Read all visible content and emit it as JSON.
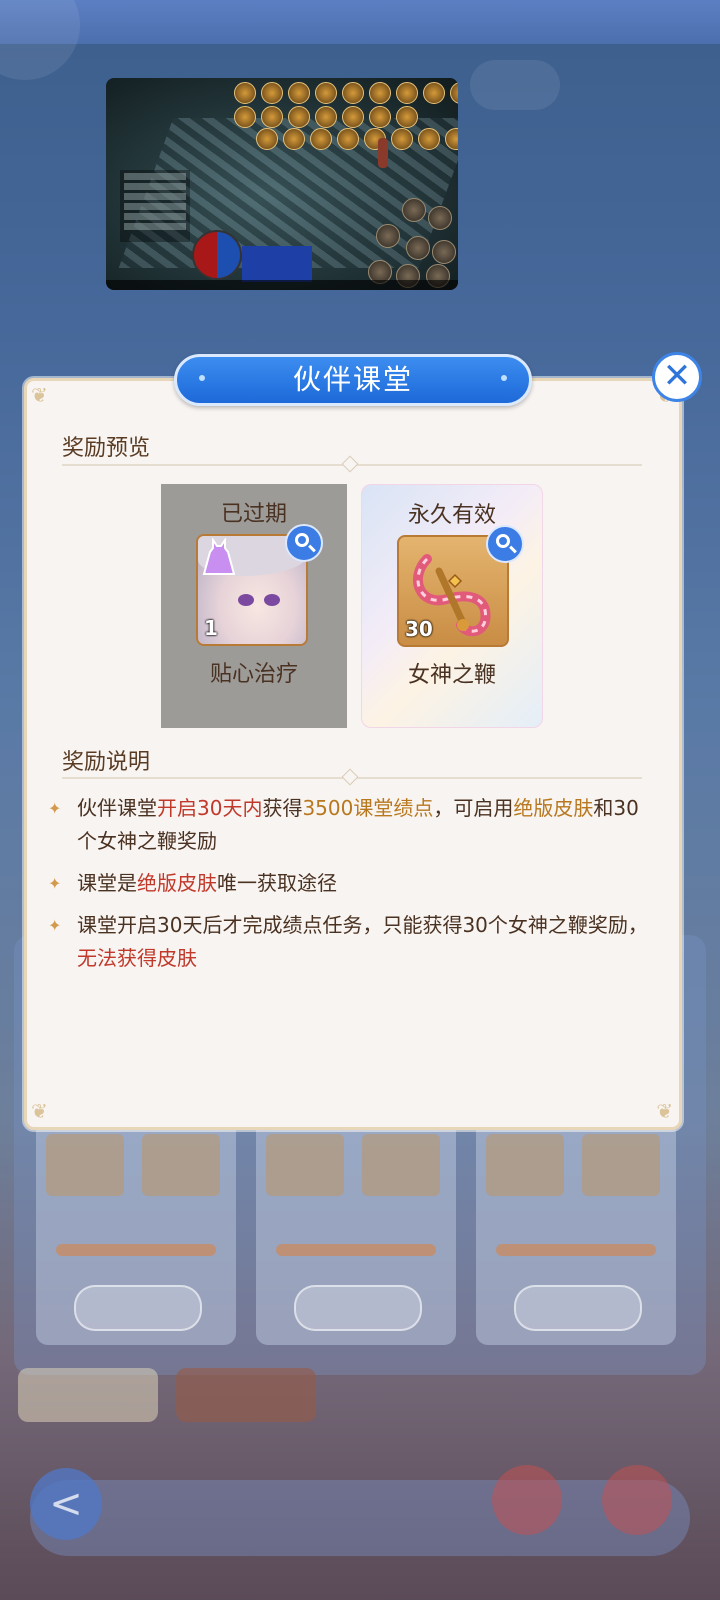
{
  "background": {
    "back_label": "<",
    "tab_labels": [
      "",
      ""
    ]
  },
  "modal": {
    "title": "伙伴课堂",
    "close_icon": "close-icon",
    "preview_section_title": "奖励预览",
    "rewards": [
      {
        "status": "已过期",
        "name": "贴心治疗",
        "count": "1",
        "icon": "dress-icon"
      },
      {
        "status": "永久有效",
        "name": "女神之鞭",
        "count": "30",
        "icon": "whip-icon"
      }
    ],
    "description_section_title": "奖励说明",
    "bullets": [
      {
        "parts": [
          {
            "text": "伙伴课堂",
            "style": "normal"
          },
          {
            "text": "开启30天内",
            "style": "red"
          },
          {
            "text": "获得",
            "style": "normal"
          },
          {
            "text": "3500课堂绩点",
            "style": "gold"
          },
          {
            "text": "，可启用",
            "style": "normal"
          },
          {
            "text": "绝版皮肤",
            "style": "gold"
          },
          {
            "text": "和30个女神之鞭奖励",
            "style": "normal"
          }
        ]
      },
      {
        "parts": [
          {
            "text": "课堂是",
            "style": "normal"
          },
          {
            "text": "绝版皮肤",
            "style": "red"
          },
          {
            "text": "唯一获取途径",
            "style": "normal"
          }
        ]
      },
      {
        "parts": [
          {
            "text": "课堂开启30天后才完成绩点任务，只能获得30个女神之鞭奖励，",
            "style": "normal"
          },
          {
            "text": "无法获得皮肤",
            "style": "red"
          }
        ]
      }
    ]
  },
  "colors": {
    "accent_blue": "#2f74d8",
    "highlight_red": "#c0392b",
    "highlight_gold": "#b8781f",
    "text_brown": "#4a3222"
  }
}
